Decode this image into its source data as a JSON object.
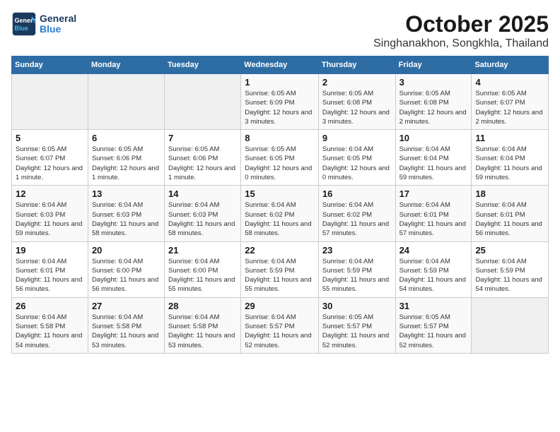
{
  "header": {
    "logo_line1": "General",
    "logo_line2": "Blue",
    "month_year": "October 2025",
    "location": "Singhanakhon, Songkhla, Thailand"
  },
  "weekdays": [
    "Sunday",
    "Monday",
    "Tuesday",
    "Wednesday",
    "Thursday",
    "Friday",
    "Saturday"
  ],
  "weeks": [
    [
      {
        "day": "",
        "info": ""
      },
      {
        "day": "",
        "info": ""
      },
      {
        "day": "",
        "info": ""
      },
      {
        "day": "1",
        "info": "Sunrise: 6:05 AM\nSunset: 6:09 PM\nDaylight: 12 hours and 3 minutes."
      },
      {
        "day": "2",
        "info": "Sunrise: 6:05 AM\nSunset: 6:08 PM\nDaylight: 12 hours and 3 minutes."
      },
      {
        "day": "3",
        "info": "Sunrise: 6:05 AM\nSunset: 6:08 PM\nDaylight: 12 hours and 2 minutes."
      },
      {
        "day": "4",
        "info": "Sunrise: 6:05 AM\nSunset: 6:07 PM\nDaylight: 12 hours and 2 minutes."
      }
    ],
    [
      {
        "day": "5",
        "info": "Sunrise: 6:05 AM\nSunset: 6:07 PM\nDaylight: 12 hours and 1 minute."
      },
      {
        "day": "6",
        "info": "Sunrise: 6:05 AM\nSunset: 6:06 PM\nDaylight: 12 hours and 1 minute."
      },
      {
        "day": "7",
        "info": "Sunrise: 6:05 AM\nSunset: 6:06 PM\nDaylight: 12 hours and 1 minute."
      },
      {
        "day": "8",
        "info": "Sunrise: 6:05 AM\nSunset: 6:05 PM\nDaylight: 12 hours and 0 minutes."
      },
      {
        "day": "9",
        "info": "Sunrise: 6:04 AM\nSunset: 6:05 PM\nDaylight: 12 hours and 0 minutes."
      },
      {
        "day": "10",
        "info": "Sunrise: 6:04 AM\nSunset: 6:04 PM\nDaylight: 11 hours and 59 minutes."
      },
      {
        "day": "11",
        "info": "Sunrise: 6:04 AM\nSunset: 6:04 PM\nDaylight: 11 hours and 59 minutes."
      }
    ],
    [
      {
        "day": "12",
        "info": "Sunrise: 6:04 AM\nSunset: 6:03 PM\nDaylight: 11 hours and 59 minutes."
      },
      {
        "day": "13",
        "info": "Sunrise: 6:04 AM\nSunset: 6:03 PM\nDaylight: 11 hours and 58 minutes."
      },
      {
        "day": "14",
        "info": "Sunrise: 6:04 AM\nSunset: 6:03 PM\nDaylight: 11 hours and 58 minutes."
      },
      {
        "day": "15",
        "info": "Sunrise: 6:04 AM\nSunset: 6:02 PM\nDaylight: 11 hours and 58 minutes."
      },
      {
        "day": "16",
        "info": "Sunrise: 6:04 AM\nSunset: 6:02 PM\nDaylight: 11 hours and 57 minutes."
      },
      {
        "day": "17",
        "info": "Sunrise: 6:04 AM\nSunset: 6:01 PM\nDaylight: 11 hours and 57 minutes."
      },
      {
        "day": "18",
        "info": "Sunrise: 6:04 AM\nSunset: 6:01 PM\nDaylight: 11 hours and 56 minutes."
      }
    ],
    [
      {
        "day": "19",
        "info": "Sunrise: 6:04 AM\nSunset: 6:01 PM\nDaylight: 11 hours and 56 minutes."
      },
      {
        "day": "20",
        "info": "Sunrise: 6:04 AM\nSunset: 6:00 PM\nDaylight: 11 hours and 56 minutes."
      },
      {
        "day": "21",
        "info": "Sunrise: 6:04 AM\nSunset: 6:00 PM\nDaylight: 11 hours and 55 minutes."
      },
      {
        "day": "22",
        "info": "Sunrise: 6:04 AM\nSunset: 5:59 PM\nDaylight: 11 hours and 55 minutes."
      },
      {
        "day": "23",
        "info": "Sunrise: 6:04 AM\nSunset: 5:59 PM\nDaylight: 11 hours and 55 minutes."
      },
      {
        "day": "24",
        "info": "Sunrise: 6:04 AM\nSunset: 5:59 PM\nDaylight: 11 hours and 54 minutes."
      },
      {
        "day": "25",
        "info": "Sunrise: 6:04 AM\nSunset: 5:59 PM\nDaylight: 11 hours and 54 minutes."
      }
    ],
    [
      {
        "day": "26",
        "info": "Sunrise: 6:04 AM\nSunset: 5:58 PM\nDaylight: 11 hours and 54 minutes."
      },
      {
        "day": "27",
        "info": "Sunrise: 6:04 AM\nSunset: 5:58 PM\nDaylight: 11 hours and 53 minutes."
      },
      {
        "day": "28",
        "info": "Sunrise: 6:04 AM\nSunset: 5:58 PM\nDaylight: 11 hours and 53 minutes."
      },
      {
        "day": "29",
        "info": "Sunrise: 6:04 AM\nSunset: 5:57 PM\nDaylight: 11 hours and 52 minutes."
      },
      {
        "day": "30",
        "info": "Sunrise: 6:05 AM\nSunset: 5:57 PM\nDaylight: 11 hours and 52 minutes."
      },
      {
        "day": "31",
        "info": "Sunrise: 6:05 AM\nSunset: 5:57 PM\nDaylight: 11 hours and 52 minutes."
      },
      {
        "day": "",
        "info": ""
      }
    ]
  ]
}
